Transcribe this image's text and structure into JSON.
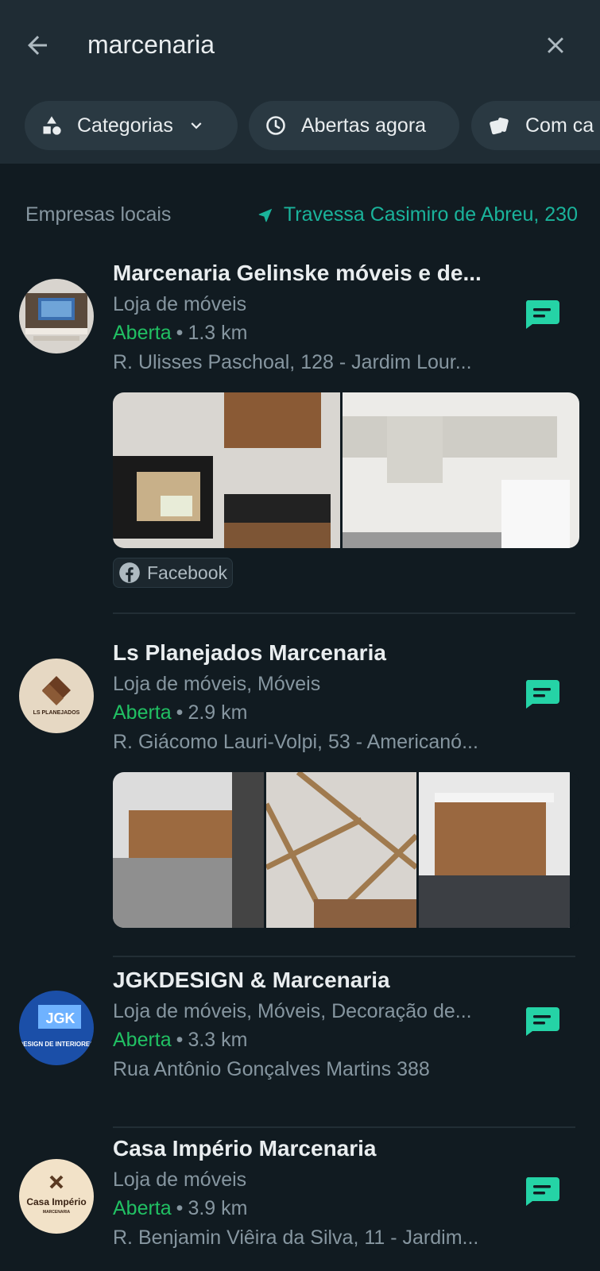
{
  "search": {
    "query": "marcenaria",
    "back_icon": "arrow-left-icon",
    "clear_icon": "close-icon"
  },
  "filters": [
    {
      "label": "Categorias",
      "icon": "shapes-icon"
    },
    {
      "label": "Abertas agora",
      "icon": "clock-icon"
    },
    {
      "label": "Com ca",
      "icon": "cards-icon"
    }
  ],
  "section": {
    "title": "Empresas locais",
    "location": "Travessa Casimiro de Abreu, 230"
  },
  "results": [
    {
      "name": "Marcenaria Gelinske móveis e de...",
      "category": "Loja de móveis",
      "status": "Aberta",
      "distance": "1.3 km",
      "address": "R. Ulisses Paschoal, 128 - Jardim Lour...",
      "source": "Facebook"
    },
    {
      "name": "Ls Planejados Marcenaria",
      "category": "Loja de móveis, Móveis",
      "status": "Aberta",
      "distance": "2.9 km",
      "address": "R. Giácomo Lauri-Volpi, 53 - Americanó...",
      "logo_text": "LS PLANEJADOS"
    },
    {
      "name": "JGKDESIGN & Marcenaria",
      "category": "Loja de móveis, Móveis, Decoração de...",
      "status": "Aberta",
      "distance": "3.3 km",
      "address": "Rua Antônio Gonçalves Martins 388",
      "logo_text": "JGK",
      "logo_subtext": "DESIGN DE INTERIORES"
    },
    {
      "name": "Casa Império Marcenaria",
      "category": "Loja de móveis",
      "status": "Aberta",
      "distance": "3.9 km",
      "address": "R. Benjamin Viêira da Silva, 11 - Jardim...",
      "logo_text": "Casa Império",
      "logo_subtext": "MARCENARIA"
    }
  ],
  "colors": {
    "background": "#111b21",
    "header": "#1f2c34",
    "chip": "#2a3942",
    "open_status": "#21c063",
    "accent": "#1ab39b",
    "chat_icon": "#25d3a6"
  }
}
